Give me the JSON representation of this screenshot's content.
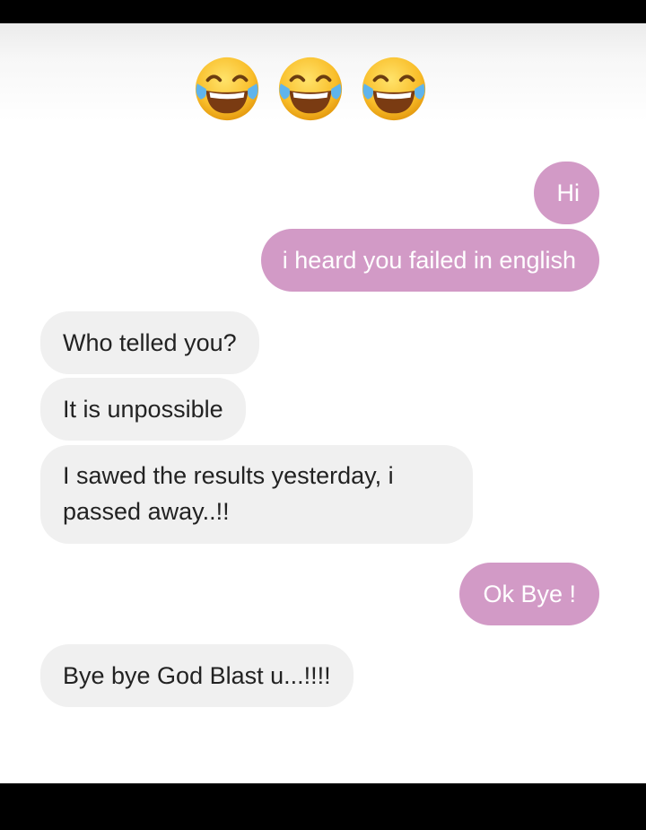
{
  "header": {
    "emojis": [
      {
        "icon": "face-with-tears-of-joy-icon"
      },
      {
        "icon": "face-with-tears-of-joy-icon"
      },
      {
        "icon": "face-with-tears-of-joy-icon"
      }
    ]
  },
  "colors": {
    "sent_bubble": "#d29ac6",
    "received_bubble": "#f0f0f0",
    "sent_text": "#ffffff",
    "received_text": "#222222"
  },
  "messages": [
    {
      "sender": "me",
      "text": "Hi"
    },
    {
      "sender": "me",
      "text": "i heard you failed in english"
    },
    {
      "sender": "them",
      "text": "Who telled you?"
    },
    {
      "sender": "them",
      "text": "It is unpossible"
    },
    {
      "sender": "them",
      "text": "I sawed the results yesterday, i passed away..!!"
    },
    {
      "sender": "me",
      "text": "Ok Bye !"
    },
    {
      "sender": "them",
      "text": "Bye bye God Blast u...!!!!"
    }
  ]
}
